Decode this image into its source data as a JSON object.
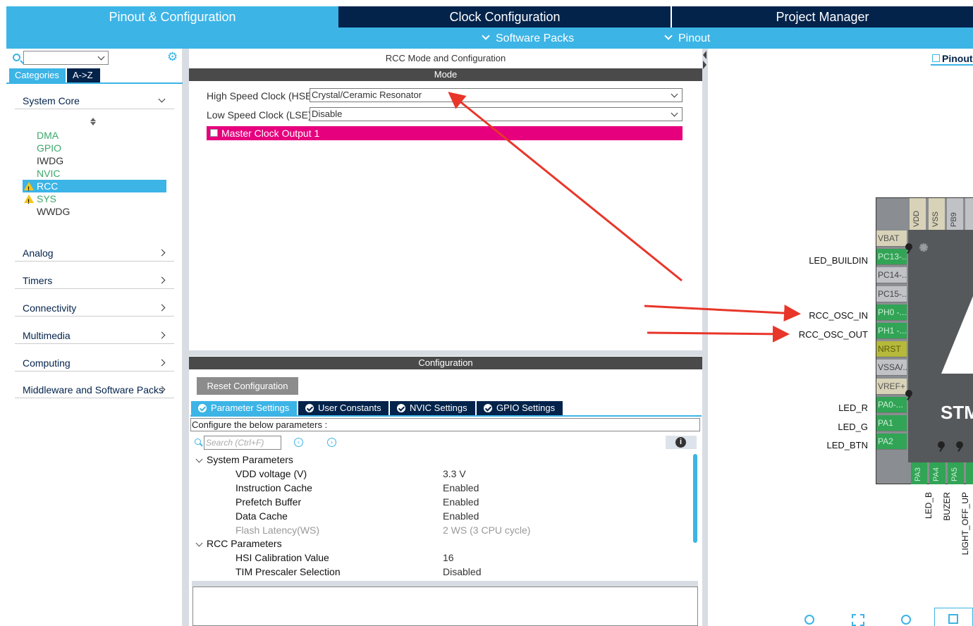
{
  "tabs": [
    "Pinout & Configuration",
    "Clock Configuration",
    "Project Manager"
  ],
  "subnav": [
    "Software Packs",
    "Pinout"
  ],
  "left": {
    "category_tabs": [
      "Categories",
      "A->Z"
    ],
    "system_core": "System Core",
    "peripherals": [
      {
        "name": "DMA",
        "state": "green"
      },
      {
        "name": "GPIO",
        "state": "green"
      },
      {
        "name": "IWDG",
        "state": "dark"
      },
      {
        "name": "NVIC",
        "state": "green"
      },
      {
        "name": "RCC",
        "state": "selected-warning"
      },
      {
        "name": "SYS",
        "state": "green-warning"
      },
      {
        "name": "WWDG",
        "state": "dark"
      }
    ],
    "sections": [
      "Analog",
      "Timers",
      "Connectivity",
      "Multimedia",
      "Computing",
      "Middleware and Software Packs"
    ]
  },
  "mode": {
    "title": "RCC Mode and Configuration",
    "bar": "Mode",
    "hse_label": "High Speed Clock (HSE)",
    "hse_value": "Crystal/Ceramic Resonator",
    "lse_label": "Low Speed Clock (LSE)",
    "lse_value": "Disable",
    "mco_label": "Master Clock Output 1"
  },
  "config": {
    "bar": "Configuration",
    "reset": "Reset Configuration",
    "tabs": [
      "Parameter Settings",
      "User Constants",
      "NVIC Settings",
      "GPIO Settings"
    ],
    "hint": "Configure the below parameters :",
    "search_placeholder": "Search (Ctrl+F)",
    "groups": [
      {
        "name": "System Parameters"
      },
      {
        "name": "RCC Parameters"
      }
    ],
    "params": [
      {
        "name": "VDD voltage (V)",
        "value": "3.3 V",
        "dim": false
      },
      {
        "name": "Instruction Cache",
        "value": "Enabled",
        "dim": false
      },
      {
        "name": "Prefetch Buffer",
        "value": "Enabled",
        "dim": false
      },
      {
        "name": "Data Cache",
        "value": "Enabled",
        "dim": false
      },
      {
        "name": "Flash Latency(WS)",
        "value": "2 WS (3 CPU cycle)",
        "dim": true
      },
      {
        "name": "HSI Calibration Value",
        "value": "16",
        "dim": false
      },
      {
        "name": "TIM Prescaler Selection",
        "value": "Disabled",
        "dim": false
      }
    ]
  },
  "pinout": {
    "tab": "Pinout",
    "chip_text": "STM",
    "top_pins": [
      "VDD",
      "VSS",
      "PB9"
    ],
    "left_pins": [
      {
        "name": "VBAT",
        "color": "beige"
      },
      {
        "name": "PC13-...",
        "color": "green"
      },
      {
        "name": "PC14-...",
        "color": "gray"
      },
      {
        "name": "PC15-...",
        "color": "gray"
      },
      {
        "name": "PH0 -...",
        "color": "green"
      },
      {
        "name": "PH1 -...",
        "color": "green"
      },
      {
        "name": "NRST",
        "color": "olive"
      },
      {
        "name": "VSSA/...",
        "color": "gray"
      },
      {
        "name": "VREF+",
        "color": "beige"
      },
      {
        "name": "PA0-...",
        "color": "green"
      },
      {
        "name": "PA1",
        "color": "green"
      },
      {
        "name": "PA2",
        "color": "green"
      }
    ],
    "signals_left": [
      "LED_BUILDIN",
      "RCC_OSC_IN",
      "RCC_OSC_OUT",
      "LED_R",
      "LED_G",
      "LED_BTN"
    ],
    "bottom_pins": [
      "PA3",
      "PA4",
      "PA5"
    ],
    "signals_bottom": [
      "LED_B",
      "BUZER",
      "LIGHT_OFF_UP"
    ]
  },
  "colors": {
    "accent": "#3cb4e6",
    "navy": "#03234b",
    "magenta": "#e6007e",
    "pin_green": "#31a455",
    "annotation": "#e8362a"
  }
}
